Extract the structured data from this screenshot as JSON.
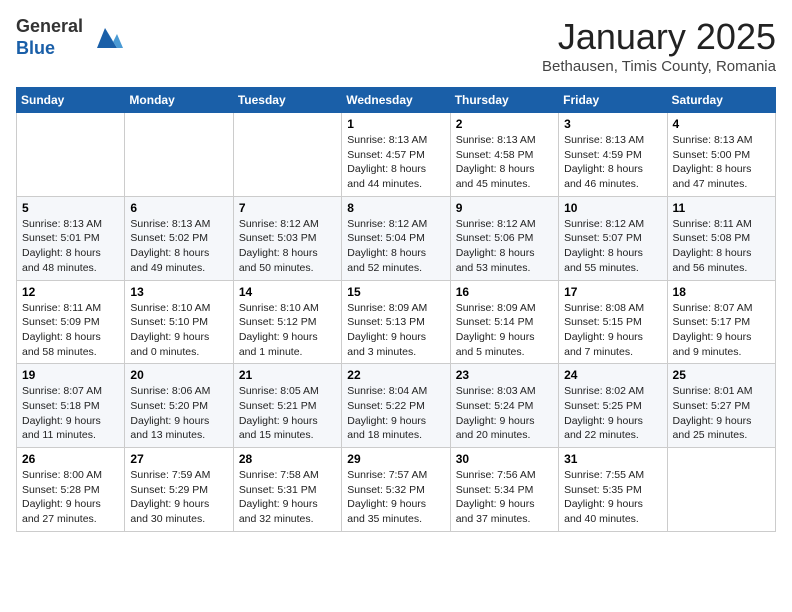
{
  "logo": {
    "general": "General",
    "blue": "Blue"
  },
  "title": "January 2025",
  "subtitle": "Bethausen, Timis County, Romania",
  "weekdays": [
    "Sunday",
    "Monday",
    "Tuesday",
    "Wednesday",
    "Thursday",
    "Friday",
    "Saturday"
  ],
  "weeks": [
    [
      {
        "day": "",
        "info": ""
      },
      {
        "day": "",
        "info": ""
      },
      {
        "day": "",
        "info": ""
      },
      {
        "day": "1",
        "info": "Sunrise: 8:13 AM\nSunset: 4:57 PM\nDaylight: 8 hours\nand 44 minutes."
      },
      {
        "day": "2",
        "info": "Sunrise: 8:13 AM\nSunset: 4:58 PM\nDaylight: 8 hours\nand 45 minutes."
      },
      {
        "day": "3",
        "info": "Sunrise: 8:13 AM\nSunset: 4:59 PM\nDaylight: 8 hours\nand 46 minutes."
      },
      {
        "day": "4",
        "info": "Sunrise: 8:13 AM\nSunset: 5:00 PM\nDaylight: 8 hours\nand 47 minutes."
      }
    ],
    [
      {
        "day": "5",
        "info": "Sunrise: 8:13 AM\nSunset: 5:01 PM\nDaylight: 8 hours\nand 48 minutes."
      },
      {
        "day": "6",
        "info": "Sunrise: 8:13 AM\nSunset: 5:02 PM\nDaylight: 8 hours\nand 49 minutes."
      },
      {
        "day": "7",
        "info": "Sunrise: 8:12 AM\nSunset: 5:03 PM\nDaylight: 8 hours\nand 50 minutes."
      },
      {
        "day": "8",
        "info": "Sunrise: 8:12 AM\nSunset: 5:04 PM\nDaylight: 8 hours\nand 52 minutes."
      },
      {
        "day": "9",
        "info": "Sunrise: 8:12 AM\nSunset: 5:06 PM\nDaylight: 8 hours\nand 53 minutes."
      },
      {
        "day": "10",
        "info": "Sunrise: 8:12 AM\nSunset: 5:07 PM\nDaylight: 8 hours\nand 55 minutes."
      },
      {
        "day": "11",
        "info": "Sunrise: 8:11 AM\nSunset: 5:08 PM\nDaylight: 8 hours\nand 56 minutes."
      }
    ],
    [
      {
        "day": "12",
        "info": "Sunrise: 8:11 AM\nSunset: 5:09 PM\nDaylight: 8 hours\nand 58 minutes."
      },
      {
        "day": "13",
        "info": "Sunrise: 8:10 AM\nSunset: 5:10 PM\nDaylight: 9 hours\nand 0 minutes."
      },
      {
        "day": "14",
        "info": "Sunrise: 8:10 AM\nSunset: 5:12 PM\nDaylight: 9 hours\nand 1 minute."
      },
      {
        "day": "15",
        "info": "Sunrise: 8:09 AM\nSunset: 5:13 PM\nDaylight: 9 hours\nand 3 minutes."
      },
      {
        "day": "16",
        "info": "Sunrise: 8:09 AM\nSunset: 5:14 PM\nDaylight: 9 hours\nand 5 minutes."
      },
      {
        "day": "17",
        "info": "Sunrise: 8:08 AM\nSunset: 5:15 PM\nDaylight: 9 hours\nand 7 minutes."
      },
      {
        "day": "18",
        "info": "Sunrise: 8:07 AM\nSunset: 5:17 PM\nDaylight: 9 hours\nand 9 minutes."
      }
    ],
    [
      {
        "day": "19",
        "info": "Sunrise: 8:07 AM\nSunset: 5:18 PM\nDaylight: 9 hours\nand 11 minutes."
      },
      {
        "day": "20",
        "info": "Sunrise: 8:06 AM\nSunset: 5:20 PM\nDaylight: 9 hours\nand 13 minutes."
      },
      {
        "day": "21",
        "info": "Sunrise: 8:05 AM\nSunset: 5:21 PM\nDaylight: 9 hours\nand 15 minutes."
      },
      {
        "day": "22",
        "info": "Sunrise: 8:04 AM\nSunset: 5:22 PM\nDaylight: 9 hours\nand 18 minutes."
      },
      {
        "day": "23",
        "info": "Sunrise: 8:03 AM\nSunset: 5:24 PM\nDaylight: 9 hours\nand 20 minutes."
      },
      {
        "day": "24",
        "info": "Sunrise: 8:02 AM\nSunset: 5:25 PM\nDaylight: 9 hours\nand 22 minutes."
      },
      {
        "day": "25",
        "info": "Sunrise: 8:01 AM\nSunset: 5:27 PM\nDaylight: 9 hours\nand 25 minutes."
      }
    ],
    [
      {
        "day": "26",
        "info": "Sunrise: 8:00 AM\nSunset: 5:28 PM\nDaylight: 9 hours\nand 27 minutes."
      },
      {
        "day": "27",
        "info": "Sunrise: 7:59 AM\nSunset: 5:29 PM\nDaylight: 9 hours\nand 30 minutes."
      },
      {
        "day": "28",
        "info": "Sunrise: 7:58 AM\nSunset: 5:31 PM\nDaylight: 9 hours\nand 32 minutes."
      },
      {
        "day": "29",
        "info": "Sunrise: 7:57 AM\nSunset: 5:32 PM\nDaylight: 9 hours\nand 35 minutes."
      },
      {
        "day": "30",
        "info": "Sunrise: 7:56 AM\nSunset: 5:34 PM\nDaylight: 9 hours\nand 37 minutes."
      },
      {
        "day": "31",
        "info": "Sunrise: 7:55 AM\nSunset: 5:35 PM\nDaylight: 9 hours\nand 40 minutes."
      },
      {
        "day": "",
        "info": ""
      }
    ]
  ]
}
